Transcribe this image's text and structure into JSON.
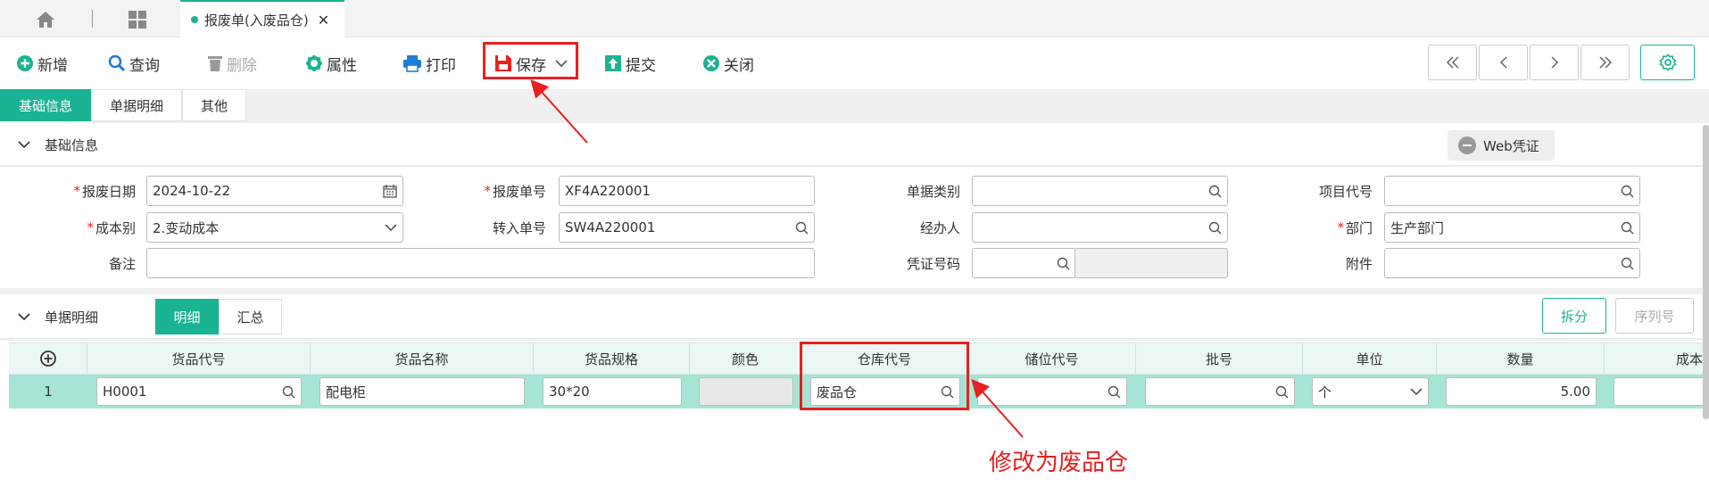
{
  "tabs": {
    "doc_tab_label": "报废单(入废品仓)",
    "close_glyph": "✕"
  },
  "toolbar": {
    "add": "新增",
    "query": "查询",
    "delete": "删除",
    "properties": "属性",
    "print": "打印",
    "save": "保存",
    "submit": "提交",
    "close": "关闭"
  },
  "section_tabs": [
    "基础信息",
    "单据明细",
    "其他"
  ],
  "basic_info": {
    "title": "基础信息",
    "web_voucher": "Web凭证",
    "fields": {
      "scrap_date_label": "报废日期",
      "scrap_date_value": "2024-10-22",
      "scrap_no_label": "报废单号",
      "scrap_no_value": "XF4A220001",
      "doc_type_label": "单据类别",
      "project_code_label": "项目代号",
      "cost_type_label": "成本别",
      "cost_type_value": "2.变动成本",
      "transfer_no_label": "转入单号",
      "transfer_no_value": "SW4A220001",
      "handler_label": "经办人",
      "dept_label": "部门",
      "dept_value": "生产部门",
      "remark_label": "备注",
      "voucher_no_label": "凭证号码",
      "attachment_label": "附件"
    }
  },
  "detail": {
    "title": "单据明细",
    "seg_detail": "明细",
    "seg_summary": "汇总",
    "split": "拆分",
    "serial": "序列号",
    "columns": [
      "货品代号",
      "货品名称",
      "货品规格",
      "颜色",
      "仓库代号",
      "储位代号",
      "批号",
      "单位",
      "数量",
      "成本"
    ],
    "row": {
      "index": "1",
      "item_code": "H0001",
      "item_name": "配电柜",
      "spec": "30*20",
      "warehouse": "废品仓",
      "unit": "个",
      "qty": "5.00"
    }
  },
  "annotation": {
    "text": "修改为废品仓",
    "color": "#e8201f"
  },
  "colors": {
    "accent": "#1ab394",
    "row_highlight": "#a6e5d6",
    "required": "#e8201f"
  }
}
